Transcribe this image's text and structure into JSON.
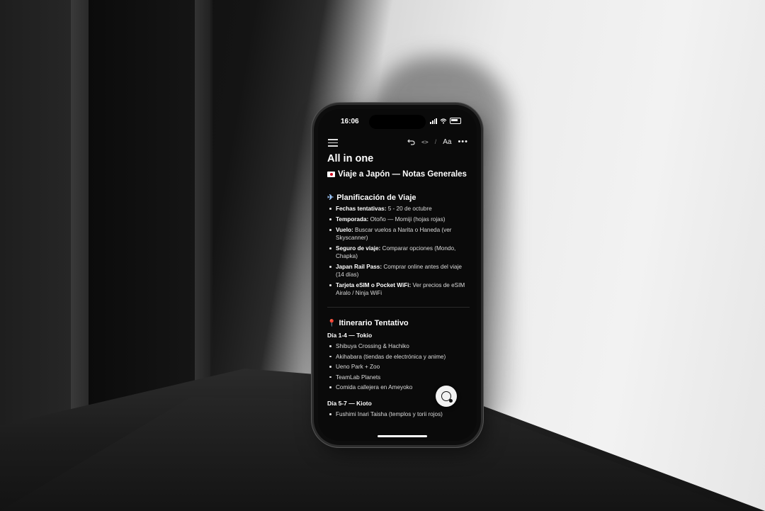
{
  "status": {
    "time": "16:06"
  },
  "toolbar": {
    "code_label": "<>",
    "slash": "/",
    "text_style_label": "Aa",
    "more_label": "•••"
  },
  "page": {
    "title": "All in one",
    "heading": "Viaje a Japón — Notas Generales"
  },
  "planning": {
    "heading": "Planificación de Viaje",
    "items": [
      {
        "label": "Fechas tentativas:",
        "text": " 5 - 20 de octubre"
      },
      {
        "label": "Temporada:",
        "text": " Otoño — Momiji (hojas rojas)"
      },
      {
        "label": "Vuelo:",
        "text": " Buscar vuelos a Narita o Haneda (ver Skyscanner)"
      },
      {
        "label": "Seguro de viaje:",
        "text": " Comparar opciones (Mondo, Chapka)"
      },
      {
        "label": "Japan Rail Pass:",
        "text": " Comprar online antes del viaje (14 días)"
      },
      {
        "label": "Tarjeta eSIM o Pocket WiFi:",
        "text": " Ver precios de eSIM Airalo / Ninja WiFi"
      }
    ]
  },
  "itinerary": {
    "heading": "Itinerario Tentativo",
    "day1_label": "Día 1-4 — Tokio",
    "day1_items": [
      "Shibuya Crossing & Hachiko",
      "Akihabara (tiendas de electrónica y anime)",
      "Ueno Park + Zoo",
      "TeamLab Planets",
      "Comida callejera en Ameyoko"
    ],
    "day2_label": "Día 5-7 — Kioto",
    "day2_items": [
      "Fushimi Inari Taisha (templos y torii rojos)"
    ]
  }
}
